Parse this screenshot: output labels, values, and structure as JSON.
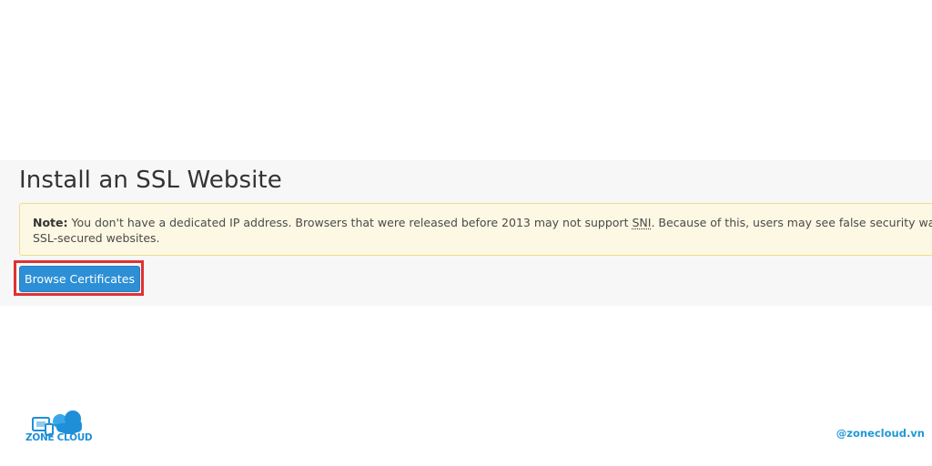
{
  "page": {
    "title": "Install an SSL Website"
  },
  "alert": {
    "note_label": "Note:",
    "text_before_sni": " You don't have a dedicated IP address. Browsers that were released before 2013 may not support ",
    "sni": "SNI",
    "text_after_sni": ". Because of this, users may see false security warnings when th",
    "line2": "SSL-secured websites."
  },
  "actions": {
    "browse_label": "Browse Certificates"
  },
  "branding": {
    "logo_text": "ZONE CLOUD",
    "handle": "@zonecloud.vn"
  },
  "colors": {
    "primary_button": "#2d8fd5",
    "highlight_border": "#e03131",
    "alert_background": "#fcf8e3",
    "brand_blue": "#1f8fd8"
  }
}
